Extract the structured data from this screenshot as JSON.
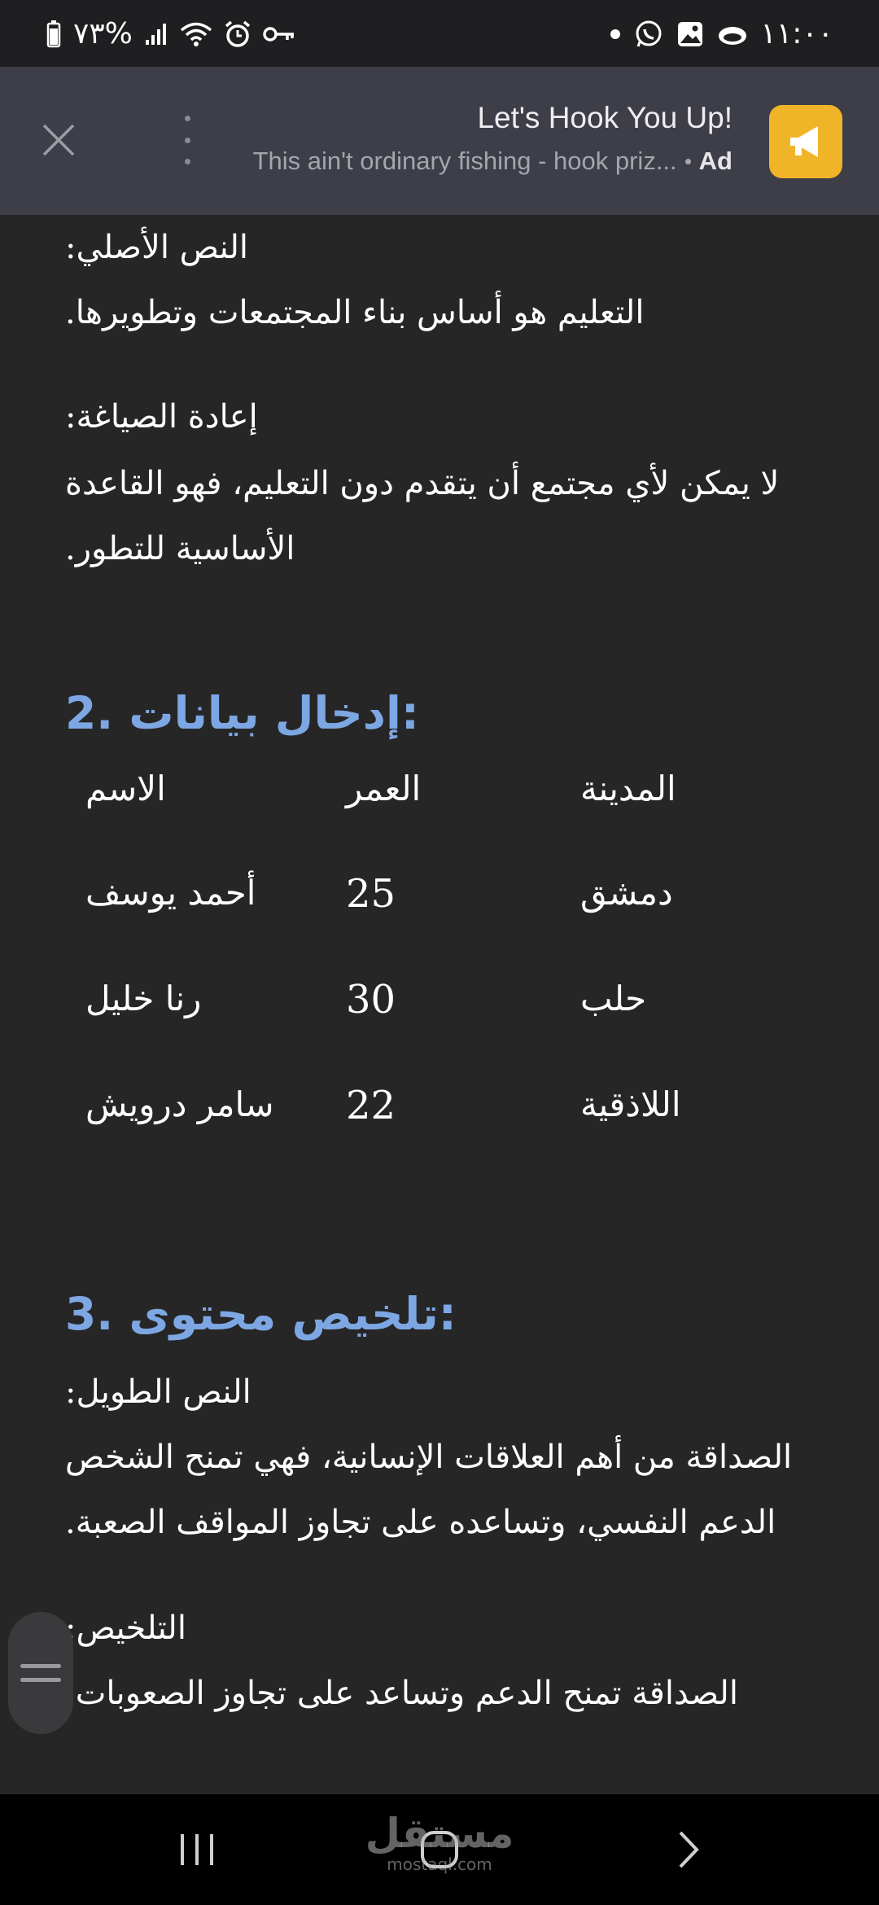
{
  "status_bar": {
    "battery": "٧٣%",
    "time": "١١:٠٠",
    "icons": [
      "battery-icon",
      "signal-icon",
      "wifi-icon",
      "alarm-icon",
      "key-icon",
      "dot-icon",
      "whatsapp-icon",
      "gallery-icon",
      "cloud-icon"
    ]
  },
  "ad": {
    "title": "Let's Hook You Up!",
    "description": "This ain't ordinary fishing - hook priz...",
    "label": "Ad",
    "logo_color": "#f0b428",
    "icons": [
      "close-icon",
      "more-vertical-icon",
      "megaphone-icon"
    ]
  },
  "document": {
    "section1": {
      "original_label": "النص الأصلي:",
      "original_text": "التعليم هو أساس بناء المجتمعات وتطويرها.",
      "rephrase_label": "إعادة الصياغة:",
      "rephrase_line1": "لا يمكن لأي مجتمع أن يتقدم دون التعليم، فهو القاعدة",
      "rephrase_line2": "الأساسية للتطور."
    },
    "section2": {
      "heading": "2. إدخال بيانات:",
      "table": {
        "headers": [
          "الاسم",
          "العمر",
          "المدينة"
        ],
        "rows": [
          [
            "أحمد يوسف",
            "25",
            "دمشق"
          ],
          [
            "رنا خليل",
            "30",
            "حلب"
          ],
          [
            "سامر درويش",
            "22",
            "اللاذقية"
          ]
        ]
      }
    },
    "section3": {
      "heading": "3. تلخيص محتوى:",
      "long_label": "النص الطويل:",
      "long_line1": "الصداقة من أهم العلاقات الإنسانية، فهي تمنح الشخص",
      "long_line2": "الدعم النفسي، وتساعده على تجاوز المواقف الصعبة.",
      "summary_label": "التلخيص:",
      "summary_text": "الصداقة تمنح الدعم وتساعد على تجاوز الصعوبات."
    }
  },
  "accent_color": "#7da7e3",
  "watermark": {
    "main": "مستقل",
    "sub": "mostaql.com"
  },
  "nav": {
    "icons": [
      "recents-icon",
      "home-icon",
      "back-icon"
    ]
  }
}
